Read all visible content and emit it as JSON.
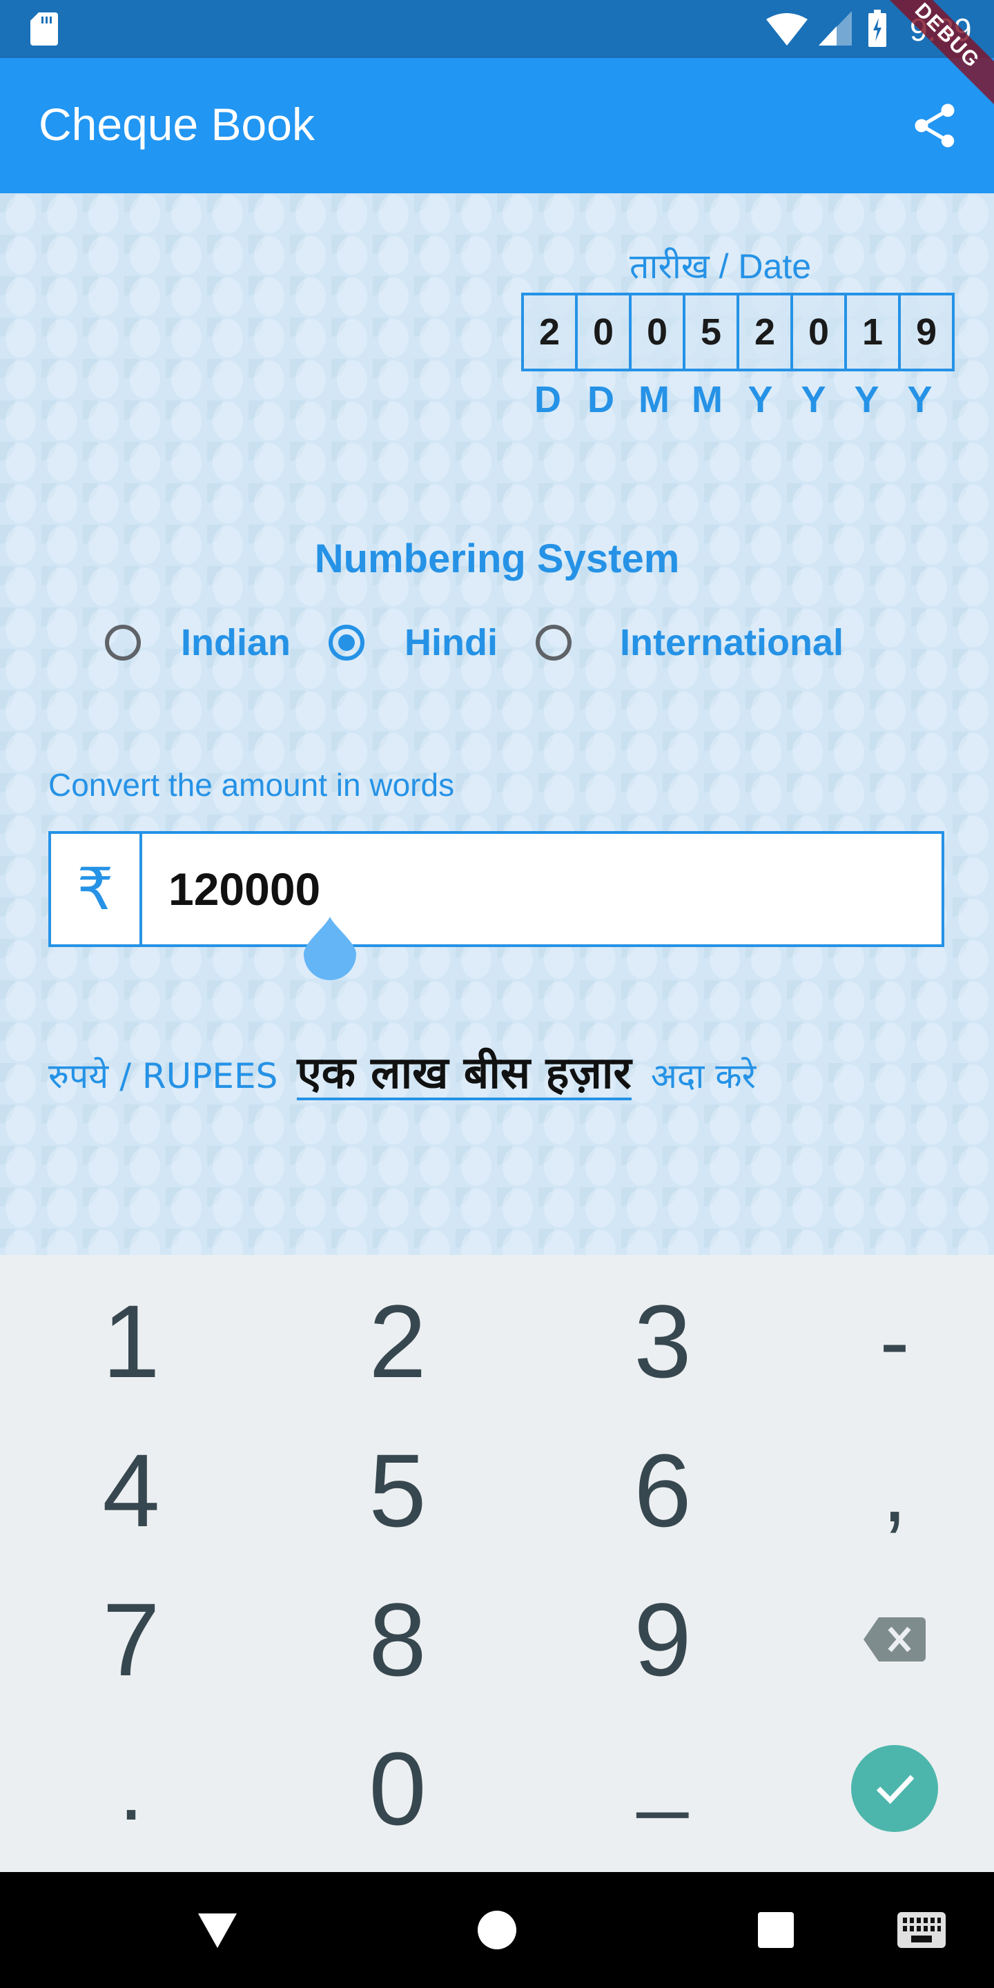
{
  "status_bar": {
    "time": "9:39",
    "icons": [
      "sd-card-icon",
      "wifi-icon",
      "signal-icon",
      "battery-charging-icon"
    ]
  },
  "app_bar": {
    "title": "Cheque Book",
    "share_icon": "share-icon",
    "debug_banner": "DEBUG",
    "color": "#2196f3"
  },
  "date": {
    "label": "तारीख / Date",
    "digits": [
      "2",
      "0",
      "0",
      "5",
      "2",
      "0",
      "1",
      "9"
    ],
    "format": [
      "D",
      "D",
      "M",
      "M",
      "Y",
      "Y",
      "Y",
      "Y"
    ]
  },
  "numbering": {
    "title": "Numbering System",
    "options": [
      {
        "label": "Indian",
        "selected": false
      },
      {
        "label": "Hindi",
        "selected": true
      },
      {
        "label": "International",
        "selected": false
      }
    ]
  },
  "amount": {
    "caption": "Convert the amount in words",
    "currency_symbol": "₹",
    "value": "120000"
  },
  "words": {
    "prefix": "रुपये / RUPEES",
    "value": "एक लाख बीस हज़ार",
    "suffix": "अदा करे"
  },
  "keyboard": {
    "rows": [
      [
        "1",
        "2",
        "3",
        "-"
      ],
      [
        "4",
        "5",
        "6",
        ","
      ],
      [
        "7",
        "8",
        "9",
        "backspace"
      ],
      [
        ".",
        "0",
        "_",
        "done"
      ]
    ],
    "done_color": "#4db6ac"
  },
  "nav_bar": {
    "buttons": [
      "back-icon",
      "home-icon",
      "recents-icon",
      "keyboard-switch-icon"
    ]
  },
  "colors": {
    "accent": "#2592e6",
    "status_bar": "#1a71b8",
    "background": "#d2e6f5",
    "keyboard_bg": "#eceff1",
    "key_text": "#37474f"
  }
}
